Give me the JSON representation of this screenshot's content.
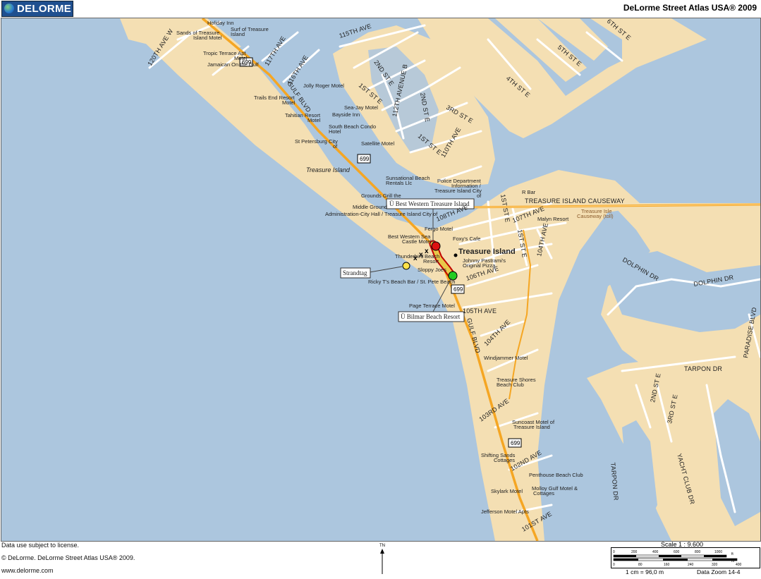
{
  "header": {
    "logo_text": "DELORME",
    "app_title": "DeLorme Street Atlas USA® 2009"
  },
  "colors": {
    "water": "#acc6de",
    "land": "#f4dfb3",
    "road_minor": "#ffffff",
    "road_major": "#f5a623",
    "route": "#e8c84a",
    "route_outline": "#c00000",
    "start_marker": "#dd1111",
    "end_marker": "#22cc22",
    "poi_marker": "#ffe24a"
  },
  "map": {
    "place_labels": {
      "treasure_island_city": "Treasure Island",
      "treasure_island_area": "Treasure Island"
    },
    "highway_shields": [
      "699",
      "699",
      "699",
      "699"
    ],
    "callouts": {
      "best_western": "Ü Best Western Treasure Island",
      "bilmar": "Ü Bilmar Beach Resort",
      "strandtag": "Strandtag"
    },
    "streets": {
      "120th_ave": "120TH AVE W",
      "117th_ave": "117TH AVE",
      "116th_ave": "116TH AVE",
      "115th_ave": "115TH AVE",
      "gulf_blvd_n": "GULF BLVD",
      "gulf_blvd_s": "GULF BLVD",
      "2nd_st_e_n": "2ND ST E",
      "1st_st_e_n": "1ST ST E",
      "112th_ave_b": "112TH AVENUE B",
      "2nd_st_e_mid": "2ND ST E",
      "3rd_st_e": "3RD ST E",
      "1st_st_e_mid": "1ST ST E",
      "110th_ave": "110TH AVE",
      "6th_st_e": "6TH ST E",
      "5th_st_e": "5TH ST E",
      "4th_st_e": "4TH ST E",
      "108th_ave": "108TH AVE",
      "107th_ave": "107TH AVE",
      "1st_st_e_s": "1ST ST E",
      "1st_st_e_s2": "1ST ST E",
      "104th_ave_e": "104TH AVE",
      "106th_ave": "106TH AVE",
      "105th_ave": "105TH AVE",
      "104th_ave": "104TH AVE",
      "103rd_ave": "103RD AVE",
      "102nd_ave": "102ND AVE",
      "101st_ave": "101ST AVE",
      "causeway": "TREASURE ISLAND CAUSEWAY",
      "dolphin_dr_1": "DOLPHIN DR",
      "dolphin_dr_2": "DOLPHIN DR",
      "paradise_blvd": "PARADISE BLVD",
      "tarpon_dr_1": "TARPON DR",
      "tarpon_dr_2": "TARPON DR",
      "2nd_st_e_s": "2ND ST E",
      "3rd_st_e_s": "3RD ST E",
      "yacht_club_dr": "YACHT CLUB DR"
    },
    "poi": {
      "holiday_inn": "Holiday Inn",
      "sands_1": "Sands of Treasure",
      "sands_2": "Island Motel",
      "surf_1": "Surf of Treasure",
      "surf_2": "Island",
      "tropic_1": "Tropic Terrace Apt",
      "tropic_2": "Motel",
      "jamaican": "Jamaican On the Gulf",
      "jolly_roger": "Jolly Roger Motel",
      "trails_1": "Trails End Resort",
      "trails_2": "Motel",
      "seajay": "Sea-Jay Motel",
      "tahitian_1": "Tahitian Resort",
      "tahitian_2": "Motel",
      "bayside": "Bayside Inn",
      "south_beach_1": "South Beach Condo",
      "south_beach_2": "Hotel",
      "st_pete_1": "St Petersburg City",
      "st_pete_2": "of",
      "satellite": "Satellite Motel",
      "sunsational_1": "Sunsational Beach",
      "sunsational_2": "Rentals Llc",
      "police_1": "Police Department",
      "police_2": "Information /",
      "police_3": "Treasure Island City",
      "police_4": "of",
      "grounds_grill": "Grounds Grill the",
      "middle_ground": "Middle Ground",
      "admin": "Administration-City Hall / Treasure Island City of",
      "r_bar": "R Bar",
      "causeway_toll_1": "Treasure Isle",
      "causeway_toll_2": "Causeway (toll)",
      "malyn": "Malyn Resort",
      "fergo": "Fergo Motel",
      "foxys": "Foxy's Cafe",
      "best_western_sea_1": "Best Western Sea",
      "best_western_sea_2": "Castle Motel",
      "thunderbird": "Thunderbird",
      "beach_1": "Beach",
      "beach_2": "Resort",
      "johnny_1": "Johnny Pastrami's",
      "johnny_2": "Original Pizza",
      "sloppy": "Sloppy Joes",
      "ricky": "Ricky T's Beach Bar / St. Pete Beach",
      "page_terrace": "Page Terrace Motel",
      "windjammer": "Windjammer Motel",
      "shores_1": "Treasure Shores",
      "shores_2": "Beach Club",
      "suncoast_1": "Suncoast Motel of",
      "suncoast_2": "Treasure Island",
      "shifting_1": "Shifting Sands",
      "shifting_2": "Cottages",
      "penthouse": "Penthouse Beach Club",
      "skylark": "Skylark Motel",
      "molloy_1": "Molloy Gulf Motel &",
      "molloy_2": "Cottages",
      "jefferson": "Jefferson Motel Apts"
    }
  },
  "footer": {
    "license": "Data use subject to license.",
    "copyright": "© DeLorme. DeLorme Street Atlas USA® 2009.",
    "website": "www.delorme.com",
    "north_label": "TN",
    "scale_title": "Scale 1 : 9.600",
    "scale_m_ticks": [
      "0",
      "200",
      "400",
      "600",
      "800",
      "1000"
    ],
    "scale_ft_ticks": [
      "0",
      "80",
      "160",
      "240",
      "320",
      "400"
    ],
    "scale_unit_top": "ft",
    "scale_unit_bottom": "m",
    "scale_cm": "1 cm = 96,0 m",
    "data_zoom": "Data Zoom 14-4"
  }
}
